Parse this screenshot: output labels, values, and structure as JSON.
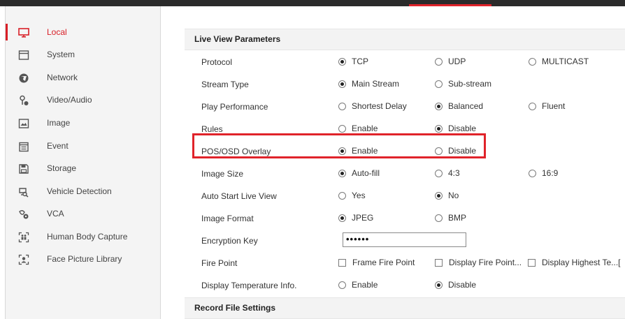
{
  "colors": {
    "accent": "#e0232a",
    "topbar": "#2b2b2b",
    "sidebar_bg": "#f4f4f4",
    "section_bg": "#f3f3f3"
  },
  "sidebar": {
    "items": [
      {
        "label": "Local",
        "icon": "monitor-icon",
        "active": true
      },
      {
        "label": "System",
        "icon": "window-icon",
        "active": false
      },
      {
        "label": "Network",
        "icon": "globe-icon",
        "active": false
      },
      {
        "label": "Video/Audio",
        "icon": "audio-icon",
        "active": false
      },
      {
        "label": "Image",
        "icon": "image-icon",
        "active": false
      },
      {
        "label": "Event",
        "icon": "calendar-icon",
        "active": false
      },
      {
        "label": "Storage",
        "icon": "save-icon",
        "active": false
      },
      {
        "label": "Vehicle Detection",
        "icon": "car-icon",
        "active": false
      },
      {
        "label": "VCA",
        "icon": "vca-icon",
        "active": false
      },
      {
        "label": "Human Body Capture",
        "icon": "human-body-icon",
        "active": false
      },
      {
        "label": "Face Picture Library",
        "icon": "face-icon",
        "active": false
      }
    ]
  },
  "sections": {
    "live_view": "Live View Parameters",
    "record_file": "Record File Settings"
  },
  "params": {
    "protocol": {
      "label": "Protocol",
      "options": [
        "TCP",
        "UDP",
        "MULTICAST"
      ],
      "selected": "TCP"
    },
    "stream_type": {
      "label": "Stream Type",
      "options": [
        "Main Stream",
        "Sub-stream"
      ],
      "selected": "Main Stream"
    },
    "play_performance": {
      "label": "Play Performance",
      "options": [
        "Shortest Delay",
        "Balanced",
        "Fluent"
      ],
      "selected": "Balanced"
    },
    "rules": {
      "label": "Rules",
      "options": [
        "Enable",
        "Disable"
      ],
      "selected": "Disable"
    },
    "pos_osd": {
      "label": "POS/OSD Overlay",
      "options": [
        "Enable",
        "Disable"
      ],
      "selected": "Enable"
    },
    "image_size": {
      "label": "Image Size",
      "options": [
        "Auto-fill",
        "4:3",
        "16:9"
      ],
      "selected": "Auto-fill"
    },
    "auto_start": {
      "label": "Auto Start Live View",
      "options": [
        "Yes",
        "No"
      ],
      "selected": "No"
    },
    "image_format": {
      "label": "Image Format",
      "options": [
        "JPEG",
        "BMP"
      ],
      "selected": "JPEG"
    },
    "encryption_key": {
      "label": "Encryption Key",
      "value": "••••••"
    },
    "fire_point": {
      "label": "Fire Point",
      "options": [
        "Frame Fire Point",
        "Display Fire Point...",
        "Display Highest Te...["
      ]
    },
    "temp_info": {
      "label": "Display Temperature Info.",
      "options": [
        "Enable",
        "Disable"
      ],
      "selected": "Disable"
    }
  }
}
